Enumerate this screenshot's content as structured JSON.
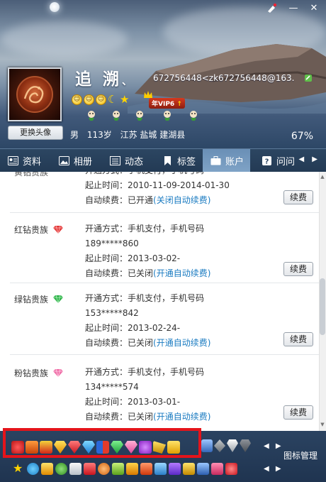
{
  "window": {
    "skin_label": "",
    "minimize_label": "—",
    "close_label": "✕"
  },
  "profile": {
    "nickname": "追 溯",
    "nickname_suffix": "、",
    "account": "672756448<zk672756448@163.",
    "gender": "男",
    "age": "113岁",
    "location": "江苏 盐城 建湖县",
    "change_avatar_label": "更换头像",
    "vip_label": "年VIP6",
    "vip_arrow": "↑",
    "completion": "67%"
  },
  "tabs": [
    {
      "label": "资料",
      "icon": "profile-card-icon",
      "active": false
    },
    {
      "label": "相册",
      "icon": "photo-icon",
      "active": false
    },
    {
      "label": "动态",
      "icon": "feed-icon",
      "active": false
    },
    {
      "label": "标签",
      "icon": "bookmark-icon",
      "active": false
    },
    {
      "label": "账户",
      "icon": "briefcase-icon",
      "active": true
    },
    {
      "label": "问问",
      "icon": "question-icon",
      "active": false
    }
  ],
  "tab_arrows": "◀ ▶",
  "accounts": {
    "partial": {
      "name": "黄钻贵族",
      "method_line": "开通方式：手机支付，手机号码",
      "time_line_label": "起止时间：",
      "time_line_value": "2010-11-09-2014-01-30",
      "auto_label": "自动续费：",
      "auto_state": "已开通",
      "auto_link": "(关闭自动续费)",
      "renew_label": "续费"
    },
    "items": [
      {
        "name": "红钻贵族",
        "method_line": "开通方式：手机支付，手机号码",
        "phone": "189*****860",
        "time_label": "起止时间：",
        "time_value": "2013-03-02-",
        "auto_label": "自动续费：",
        "auto_state": "已关闭",
        "auto_link": "(开通自动续费)",
        "renew_label": "续费",
        "gem_color": "#e23c3c"
      },
      {
        "name": "绿钻贵族",
        "method_line": "开通方式：手机支付，手机号码",
        "phone": "153*****842",
        "time_label": "起止时间：",
        "time_value": "2013-02-24-",
        "auto_label": "自动续费：",
        "auto_state": "已关闭",
        "auto_link": "(开通自动续费)",
        "renew_label": "续费",
        "gem_color": "#2fb34a"
      },
      {
        "name": "粉钻贵族",
        "method_line": "开通方式：手机支付，手机号码",
        "phone": "134*****574",
        "time_label": "起止时间：",
        "time_value": "2013-03-01-",
        "auto_label": "自动续费：",
        "auto_state": "已关闭",
        "auto_link": "(开通自动续费)",
        "renew_label": "续费",
        "gem_color": "#ef6fa8"
      }
    ]
  },
  "bottom": {
    "manage_label": "图标管理",
    "arrows": "◀ ▶",
    "badge_icons_row1": [
      "heart-badge-icon",
      "year-vip-icon",
      "red-badge-icon",
      "yellow-diamond-icon",
      "red-diamond-icon",
      "blue-diamond-icon",
      "qq-badge-icon",
      "green-diamond-icon",
      "pink-diamond-icon",
      "purple-diamond-icon",
      "golden-badge-icon",
      "book-badge-icon"
    ],
    "gray_icons": [
      "computer-icon",
      "gray-diamond-icon",
      "silver-diamond-icon",
      "dark-diamond-icon"
    ],
    "badge_icons_row2": [
      "star-icon",
      "qzone-icon",
      "game-icon",
      "penguin-icon",
      "mail-icon",
      "badge-2-icon",
      "pet-icon",
      "music-icon",
      "gift-icon",
      "app-icon",
      "phone-icon",
      "car-icon",
      "game2-icon",
      "tool-icon",
      "shop-icon",
      "heart-icon"
    ]
  }
}
